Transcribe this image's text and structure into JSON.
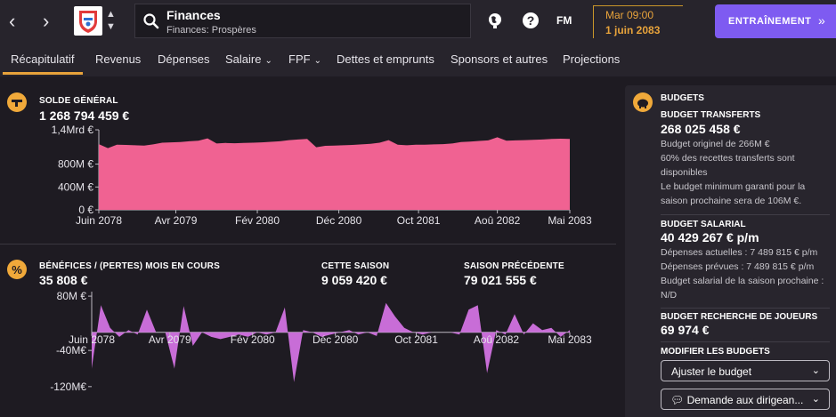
{
  "header": {
    "back_icon": "chevron-left-icon",
    "forward_icon": "chevron-right-icon",
    "title": "Finances",
    "subtitle": "Finances: Prospères",
    "fm_logo": "FM",
    "time": "Mar 09:00",
    "date": "1 juin 2083",
    "continue_label": "ENTRAÎNEMENT",
    "accent_color": "#7e5bf1",
    "date_color": "#e8a33b"
  },
  "tabs": [
    {
      "label": "Récapitulatif",
      "active": true
    },
    {
      "label": "Revenus"
    },
    {
      "label": "Dépenses"
    },
    {
      "label": "Salaire",
      "dropdown": true
    },
    {
      "label": "FPF",
      "dropdown": true
    },
    {
      "label": "Dettes et emprunts"
    },
    {
      "label": "Sponsors et autres"
    },
    {
      "label": "Projections"
    }
  ],
  "balance": {
    "label": "SOLDE GÉNÉRAL",
    "value": "1 268 794 459 €"
  },
  "profit": {
    "label": "BÉNÉFICES / (PERTES) MOIS EN COURS",
    "value": "35 808 €",
    "season_label": "CETTE SAISON",
    "season_value": "9 059 420 €",
    "prev_label": "SAISON PRÉCÉDENTE",
    "prev_value": "79 021 555 €"
  },
  "chart_data": [
    {
      "type": "area",
      "color": "#f06292",
      "x_tick_labels": [
        "Juin 2078",
        "Avr 2079",
        "Fév 2080",
        "Déc 2080",
        "Oct 2081",
        "Aoû 2082",
        "Mai 2083"
      ],
      "y_tick_labels": [
        "1,4Mrd €",
        "800M €",
        "400M €",
        "0 €"
      ],
      "ylim": [
        0,
        1400000000
      ],
      "values": [
        1150000000,
        1080000000,
        1140000000,
        1135000000,
        1130000000,
        1125000000,
        1145000000,
        1175000000,
        1180000000,
        1185000000,
        1200000000,
        1210000000,
        1250000000,
        1160000000,
        1170000000,
        1165000000,
        1170000000,
        1175000000,
        1180000000,
        1190000000,
        1200000000,
        1220000000,
        1230000000,
        1240000000,
        1095000000,
        1120000000,
        1125000000,
        1130000000,
        1135000000,
        1145000000,
        1155000000,
        1175000000,
        1220000000,
        1140000000,
        1130000000,
        1140000000,
        1140000000,
        1145000000,
        1150000000,
        1160000000,
        1185000000,
        1195000000,
        1205000000,
        1215000000,
        1270000000,
        1210000000,
        1215000000,
        1220000000,
        1225000000,
        1230000000,
        1240000000,
        1245000000,
        1240000000
      ]
    },
    {
      "type": "area",
      "color": "#c86dd7",
      "x_tick_labels": [
        "Juin 2078",
        "Avr 2079",
        "Fév 2080",
        "Déc 2080",
        "Oct 2081",
        "Aoû 2082",
        "Mai 2083"
      ],
      "y_tick_labels": [
        "80M €",
        "-40M€",
        "-120M€"
      ],
      "ylim": [
        -140000000,
        90000000
      ],
      "values": [
        -80000000,
        60000000,
        10000000,
        -10000000,
        5000000,
        -5000000,
        50000000,
        0,
        0,
        -80000000,
        58000000,
        -30000000,
        0,
        -10000000,
        -15000000,
        -10000000,
        -5000000,
        -10000000,
        0,
        -5000000,
        0,
        55000000,
        -110000000,
        5000000,
        0,
        -10000000,
        -5000000,
        0,
        5000000,
        -5000000,
        0,
        -8000000,
        65000000,
        35000000,
        10000000,
        0,
        -5000000,
        0,
        0,
        0,
        -5000000,
        50000000,
        60000000,
        -90000000,
        5000000,
        -5000000,
        40000000,
        -5000000,
        20000000,
        5000000,
        10000000,
        -10000000,
        5000000
      ]
    }
  ],
  "budgets": {
    "title": "BUDGETS",
    "transfer_label": "BUDGET TRANSFERTS",
    "transfer_value": "268 025 458 €",
    "transfer_lines": [
      "Budget originel de 266M €",
      "60% des recettes transferts sont disponibles",
      "Le budget minimum garanti pour la saison prochaine sera de 106M €."
    ],
    "salary_label": "BUDGET SALARIAL",
    "salary_value": "40 429 267 € p/m",
    "salary_lines": [
      "Dépenses actuelles : 7 489 815 € p/m",
      "Dépenses prévues : 7 489 815 € p/m",
      "Budget salarial de la saison prochaine : N/D"
    ],
    "scouting_label": "BUDGET RECHERCHE DE JOUEURS",
    "scouting_value": "69 974 €",
    "modify_label": "MODIFIER LES BUDGETS",
    "adjust_button": "Ajuster le budget",
    "request_button": "Demande aux dirigean..."
  }
}
